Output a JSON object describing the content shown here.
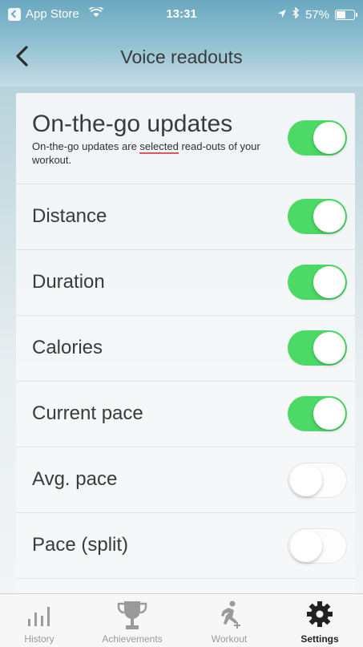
{
  "status_bar": {
    "back_app_label": "App Store",
    "time": "13:31",
    "battery_percent": "57%",
    "battery_level": 0.57
  },
  "nav": {
    "title": "Voice readouts"
  },
  "settings": [
    {
      "label": "On-the-go updates",
      "description_pre": "On-the-go updates are ",
      "description_highlight": "selected",
      "description_post": " read-outs of your workout.",
      "enabled": true
    },
    {
      "label": "Distance",
      "enabled": true
    },
    {
      "label": "Duration",
      "enabled": true
    },
    {
      "label": "Calories",
      "enabled": true
    },
    {
      "label": "Current pace",
      "enabled": true
    },
    {
      "label": "Avg. pace",
      "enabled": false
    },
    {
      "label": "Pace (split)",
      "enabled": false
    }
  ],
  "tabs": [
    {
      "label": "History",
      "icon": "bar-chart-icon",
      "active": false
    },
    {
      "label": "Achievements",
      "icon": "trophy-icon",
      "active": false
    },
    {
      "label": "Workout",
      "icon": "runner-icon",
      "active": false
    },
    {
      "label": "Settings",
      "icon": "gear-icon",
      "active": true
    }
  ],
  "colors": {
    "toggle_on": "#4cd965",
    "header_blue": "#6aa8bf"
  }
}
